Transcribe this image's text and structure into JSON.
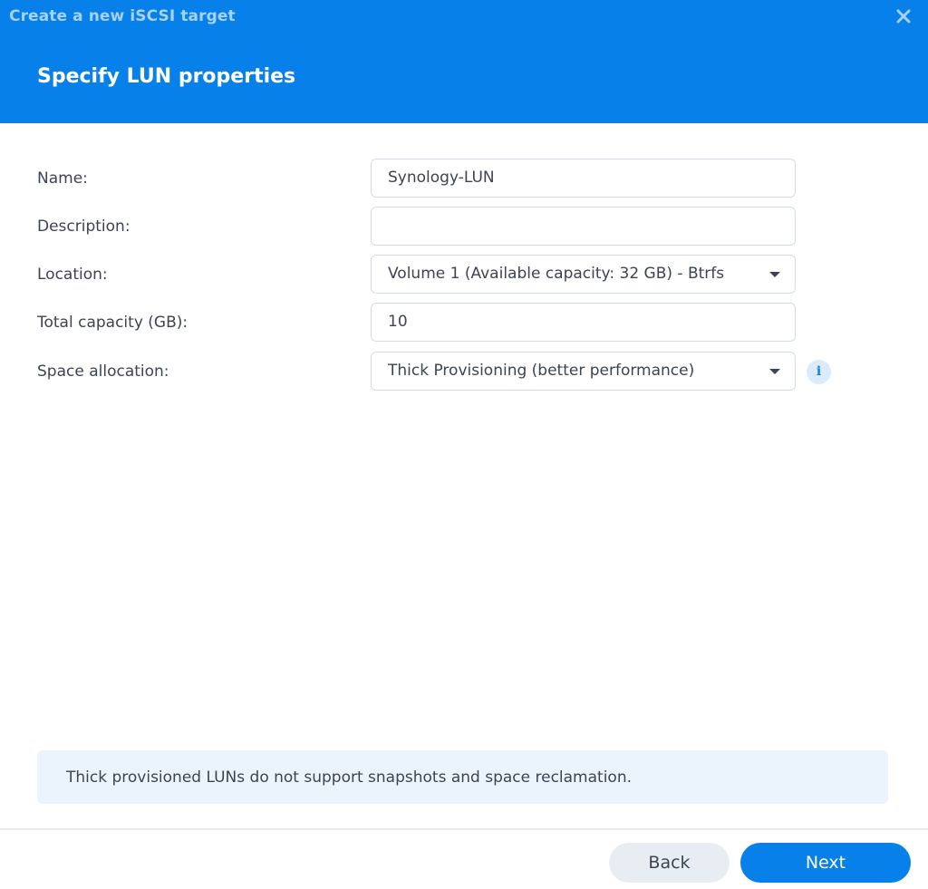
{
  "window": {
    "title": "Create a new iSCSI target",
    "close_icon": "close-icon"
  },
  "header": {
    "step_title": "Specify LUN properties"
  },
  "form": {
    "name": {
      "label": "Name:",
      "value": "Synology-LUN"
    },
    "description": {
      "label": "Description:",
      "value": ""
    },
    "location": {
      "label": "Location:",
      "selected": "Volume 1 (Available capacity: 32 GB) - Btrfs"
    },
    "total_capacity": {
      "label": "Total capacity (GB):",
      "value": "10"
    },
    "space_allocation": {
      "label": "Space allocation:",
      "selected": "Thick Provisioning (better performance)",
      "info_icon": "i"
    }
  },
  "notice": {
    "text": "Thick provisioned LUNs do not support snapshots and space reclamation."
  },
  "footer": {
    "back_label": "Back",
    "next_label": "Next"
  },
  "colors": {
    "accent": "#0780ea",
    "notice_bg": "#ebf4fd",
    "secondary_button": "#e8edf3"
  }
}
